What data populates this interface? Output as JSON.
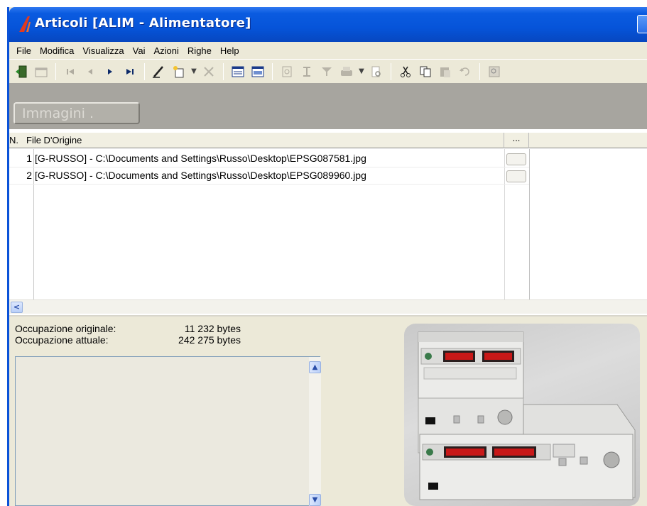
{
  "window": {
    "title": "Articoli [ALIM - Alimentatore]"
  },
  "menu": {
    "items": [
      {
        "label": "File"
      },
      {
        "label": "Modifica"
      },
      {
        "label": "Visualizza"
      },
      {
        "label": "Vai"
      },
      {
        "label": "Azioni"
      },
      {
        "label": "Righe"
      },
      {
        "label": "Help"
      }
    ]
  },
  "toolbar": {
    "icons": [
      "exit-door-icon",
      "properties-icon",
      "first-record-icon",
      "previous-record-icon",
      "next-record-icon",
      "last-record-icon",
      "edit-pencil-icon",
      "new-record-icon",
      "delete-icon",
      "form-view-icon",
      "table-view-icon",
      "refresh-icon",
      "sort-icon",
      "filter-icon",
      "print-icon",
      "print-preview-icon",
      "cut-icon",
      "copy-icon",
      "paste-icon",
      "undo-icon",
      "zoom-icon"
    ]
  },
  "tab_button": {
    "label": "Immagini ."
  },
  "grid": {
    "columns": {
      "number": "N.",
      "file": "File D'Origine",
      "action": "..."
    },
    "rows": [
      {
        "n": "1",
        "path": "[G-RUSSO] - C:\\Documents and Settings\\Russo\\Desktop\\EPSG087581.jpg"
      },
      {
        "n": "2",
        "path": "[G-RUSSO] - C:\\Documents and Settings\\Russo\\Desktop\\EPSG089960.jpg"
      }
    ]
  },
  "details": {
    "original_label": "Occupazione originale:",
    "original_value": "11 232 bytes",
    "current_label": "Occupazione attuale:",
    "current_value": "242 275 bytes"
  },
  "colors": {
    "titlebar": "#0654d9",
    "display_red": "#d01818",
    "strip": "#a7a59f"
  }
}
